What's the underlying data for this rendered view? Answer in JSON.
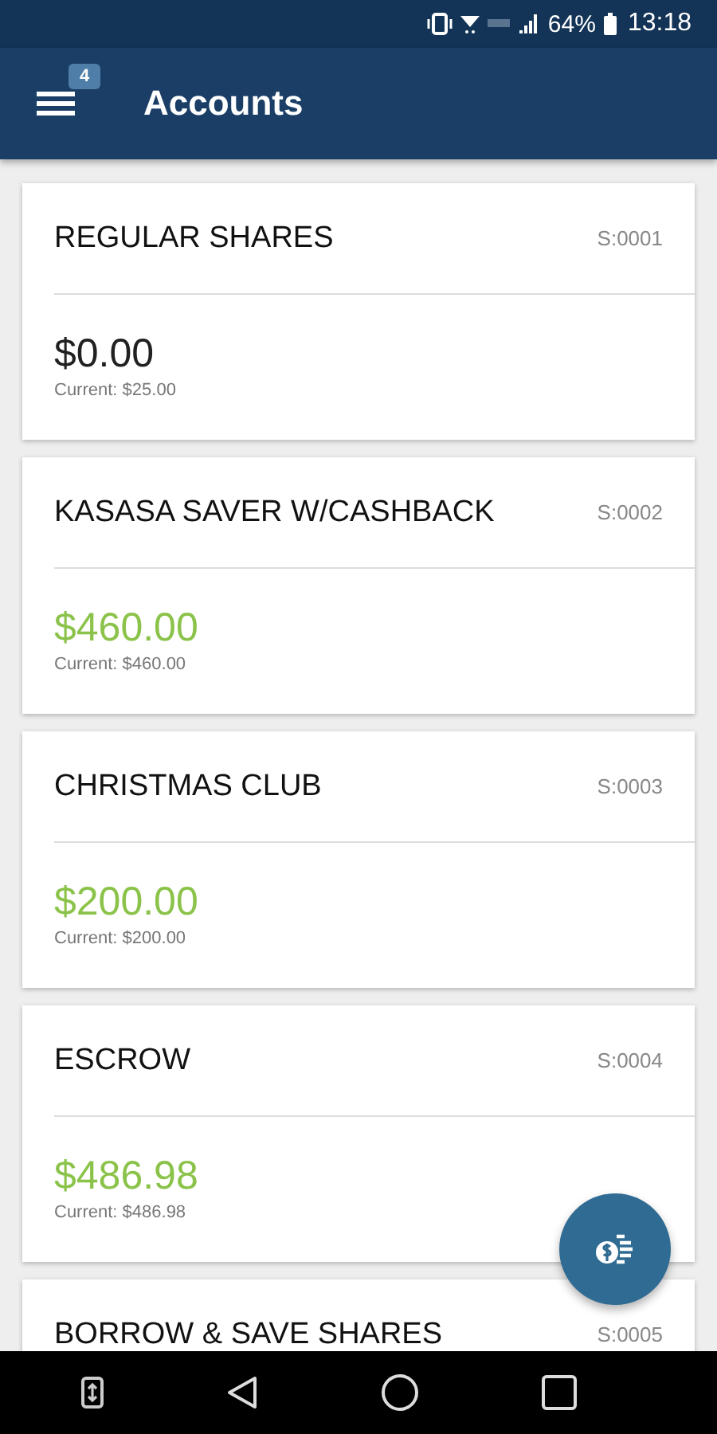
{
  "status_bar": {
    "battery": "64%",
    "time": "13:18"
  },
  "app_bar": {
    "title": "Accounts",
    "menu_badge": "4"
  },
  "accounts": [
    {
      "name": "REGULAR SHARES",
      "id": "S:0001",
      "balance": "$0.00",
      "current": "Current: $25.00",
      "color": "#212121"
    },
    {
      "name": "KASASA SAVER W/CASHBACK",
      "id": "S:0002",
      "balance": "$460.00",
      "current": "Current: $460.00",
      "color": "#8bc34a"
    },
    {
      "name": "CHRISTMAS CLUB",
      "id": "S:0003",
      "balance": "$200.00",
      "current": "Current: $200.00",
      "color": "#8bc34a"
    },
    {
      "name": "ESCROW",
      "id": "S:0004",
      "balance": "$486.98",
      "current": "Current: $486.98",
      "color": "#8bc34a"
    },
    {
      "name": "BORROW & SAVE SHARES",
      "id": "S:0005"
    }
  ]
}
